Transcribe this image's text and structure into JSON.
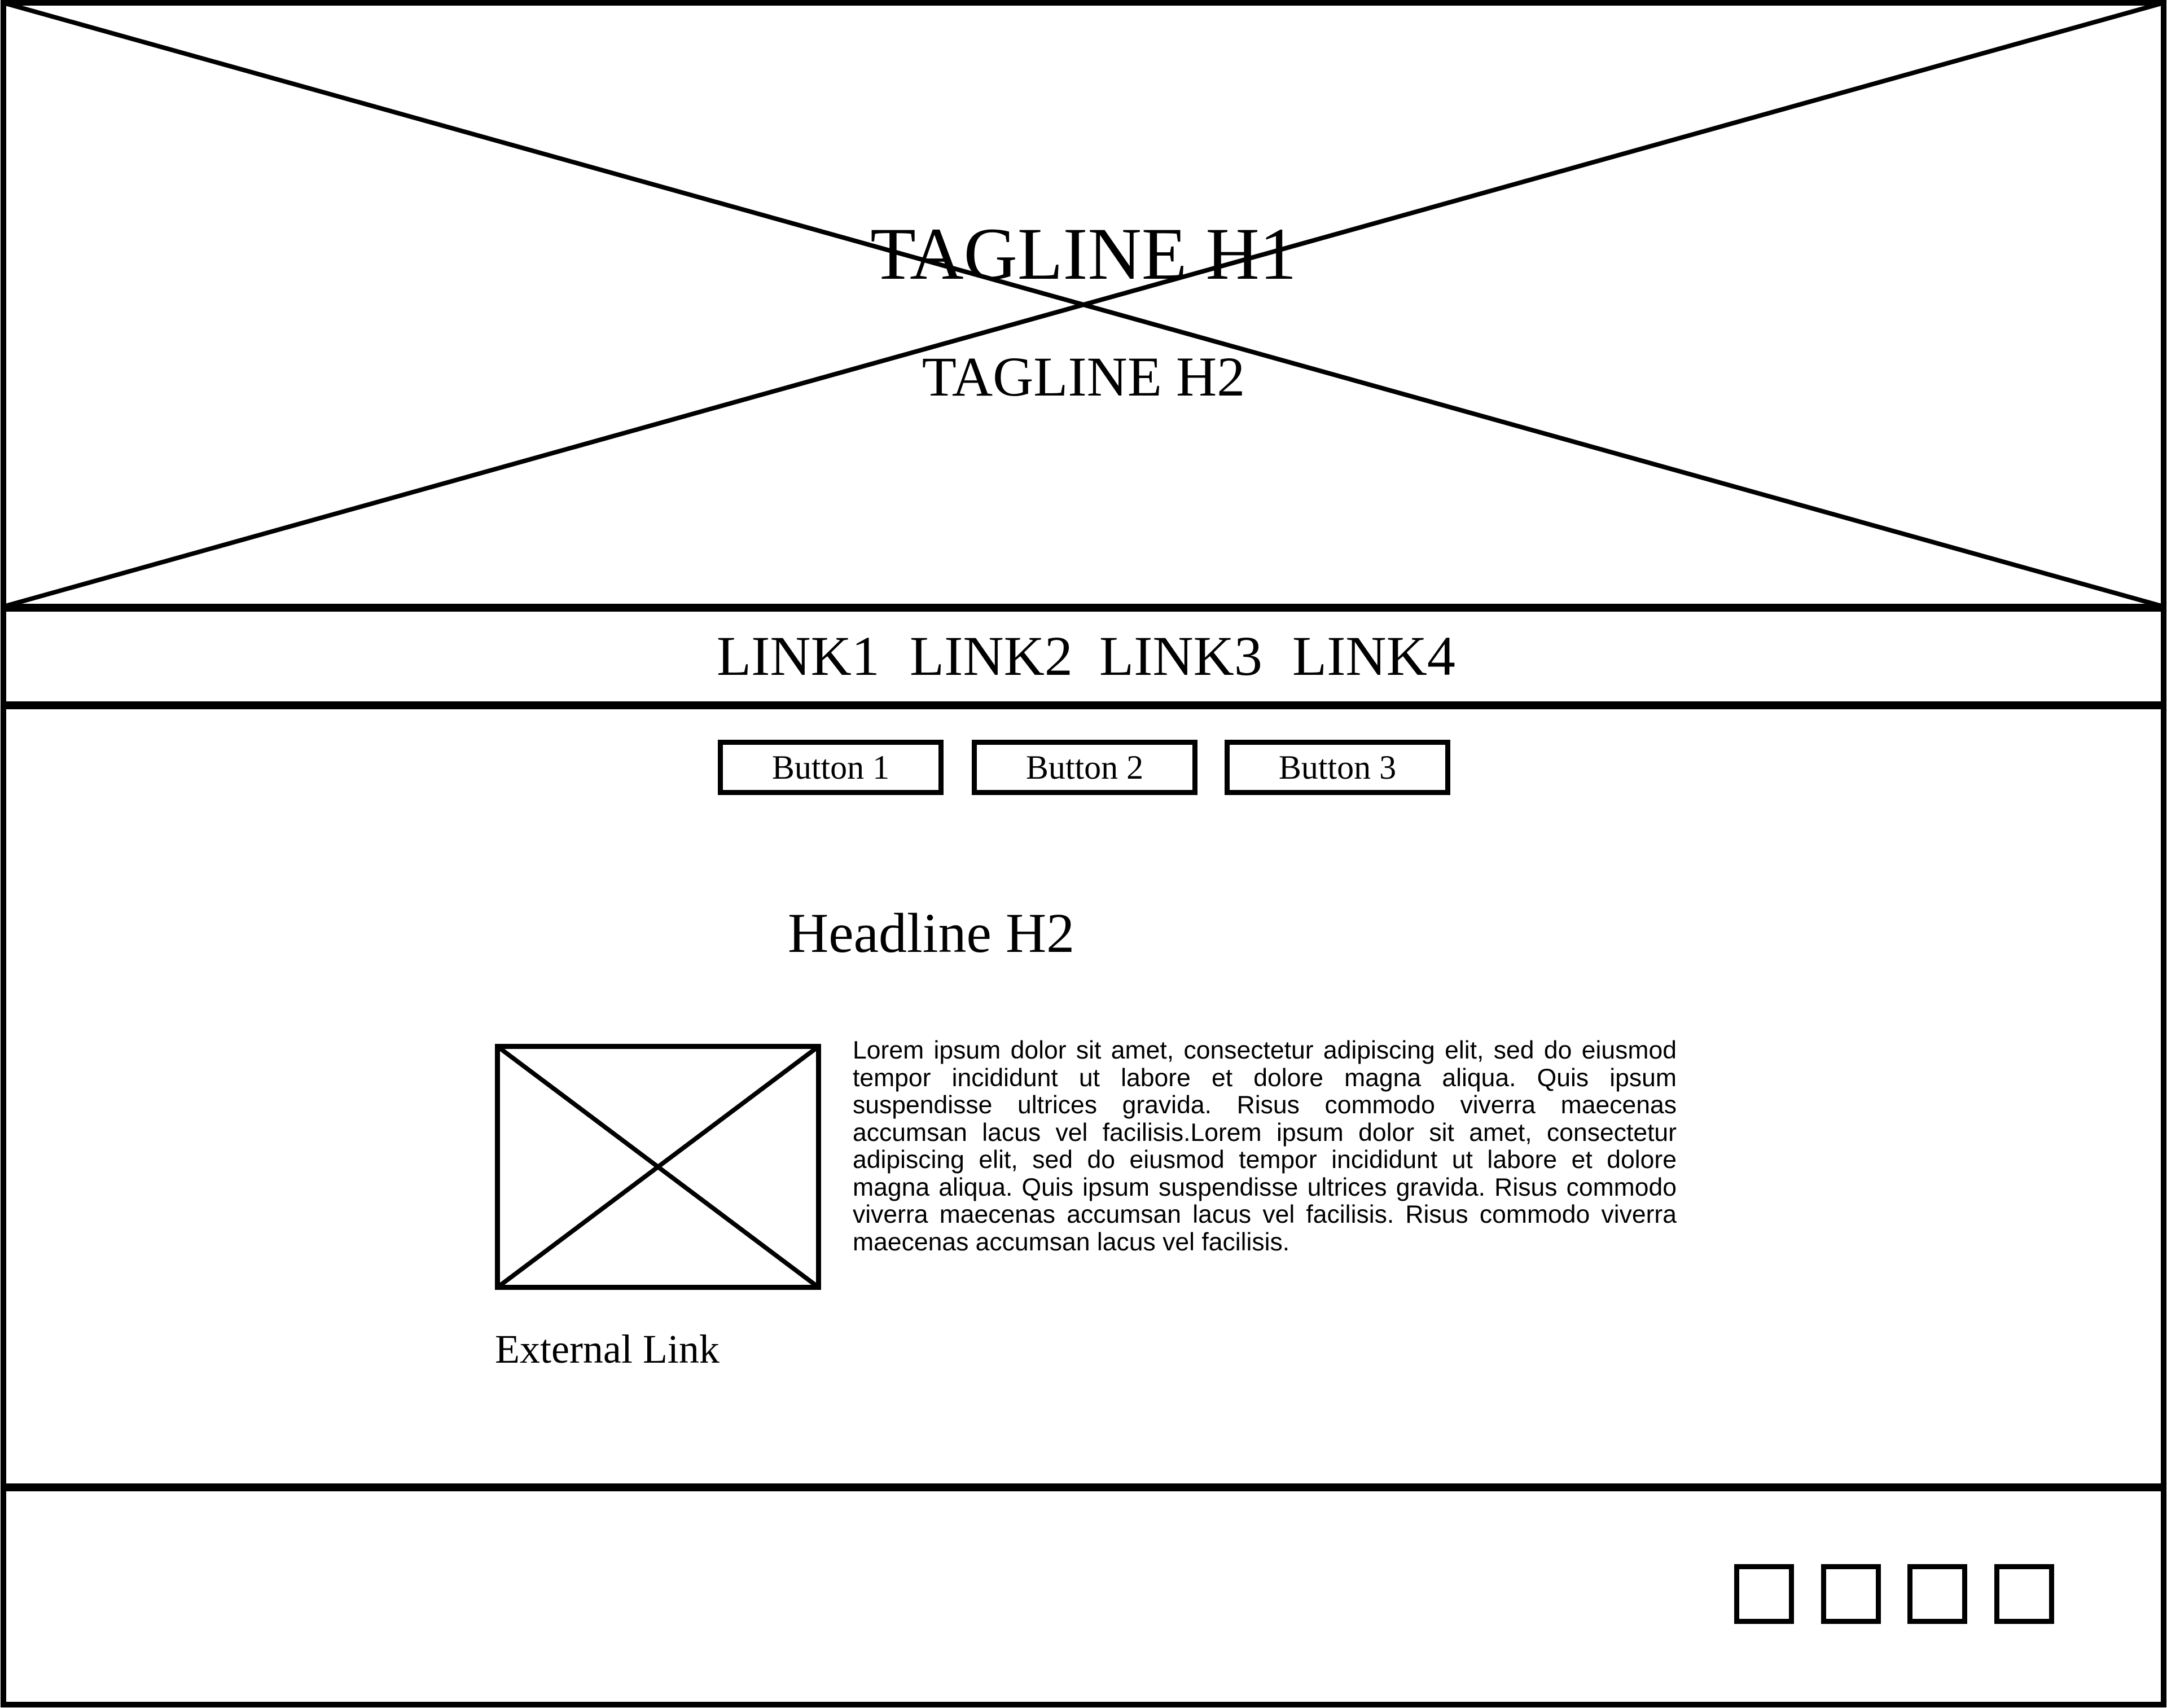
{
  "hero": {
    "title": "TAGLINE H1",
    "subtitle": "TAGLINE H2"
  },
  "nav": {
    "links": [
      "LINK1",
      "LINK2",
      "LINK3",
      "LINK4"
    ]
  },
  "buttons": [
    "Button 1",
    "Button 2",
    "Button 3"
  ],
  "main": {
    "headline": "Headline H2",
    "body": "Lorem ipsum dolor sit amet, consectetur adipiscing elit, sed do eiusmod tempor incididunt ut labore et dolore magna aliqua. Quis ipsum suspendisse ultrices gravida. Risus commodo viverra maecenas accumsan lacus vel facilisis.Lorem ipsum dolor sit amet, consectetur adipiscing elit, sed do eiusmod tempor incididunt ut labore et dolore magna aliqua. Quis ipsum suspendisse ultrices gravida. Risus commodo viverra maecenas accumsan lacus vel facilisis. Risus commodo viverra maecenas accumsan lacus vel facilisis.",
    "external_link": "External Link"
  },
  "footer": {
    "social_icons": [
      "social-icon-placeholder",
      "social-icon-placeholder",
      "social-icon-placeholder",
      "social-icon-placeholder"
    ]
  },
  "colors": {
    "stroke": "#000000",
    "background": "#ffffff"
  }
}
